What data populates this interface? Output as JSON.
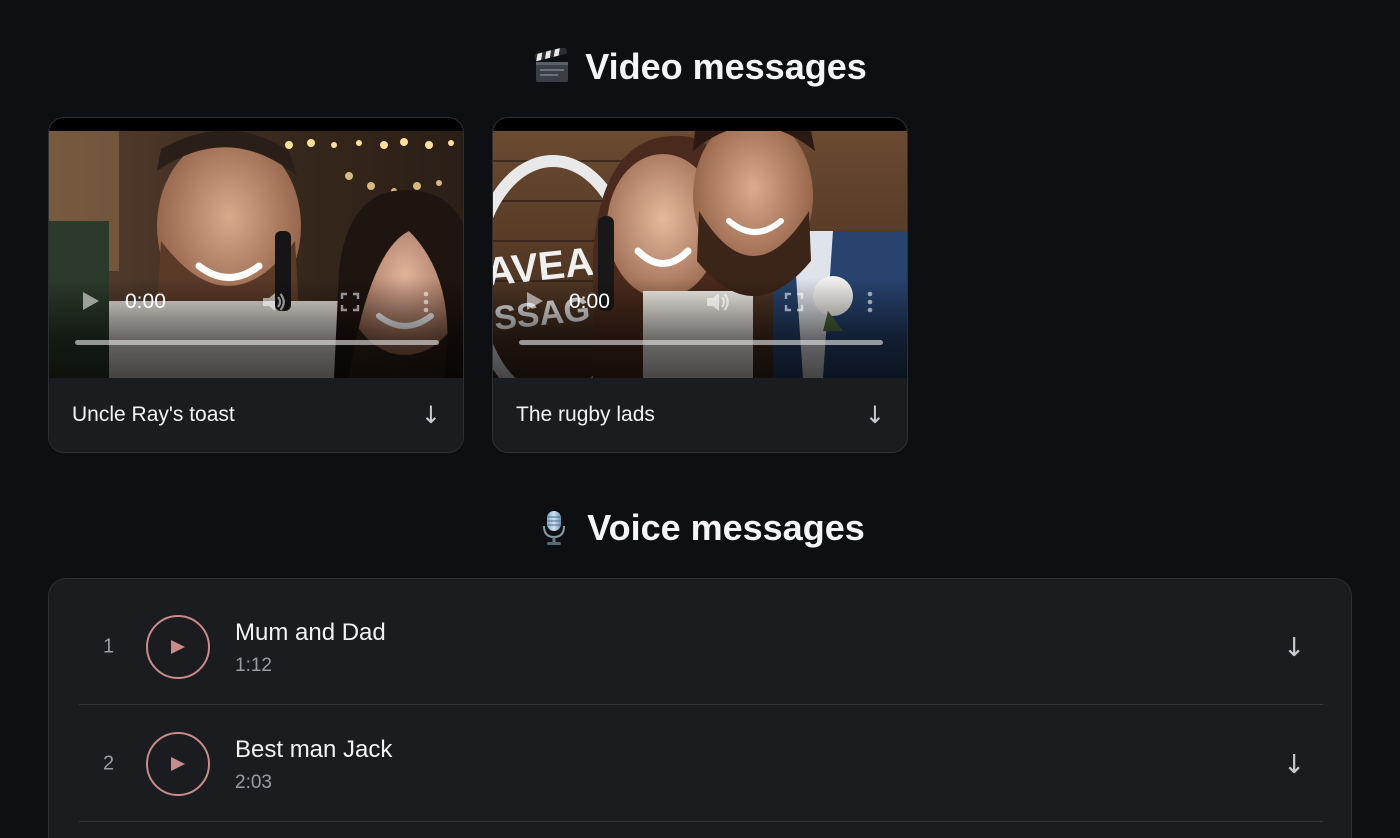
{
  "video_section": {
    "title": "Video messages",
    "icon": "clapperboard-icon",
    "items": [
      {
        "title": "Uncle Ray's toast",
        "time": "0:00"
      },
      {
        "title": "The rugby lads",
        "time": "0:00"
      }
    ]
  },
  "voice_section": {
    "title": "Voice messages",
    "icon": "microphone-icon",
    "items": [
      {
        "number": "1",
        "title": "Mum and Dad",
        "duration": "1:12"
      },
      {
        "number": "2",
        "title": "Best man Jack",
        "duration": "2:03"
      }
    ]
  },
  "labels": {
    "download_glyph": "↓"
  },
  "colors": {
    "background": "#0e0f12",
    "card": "#1b1c20",
    "accent_play": "#c98b8b"
  }
}
